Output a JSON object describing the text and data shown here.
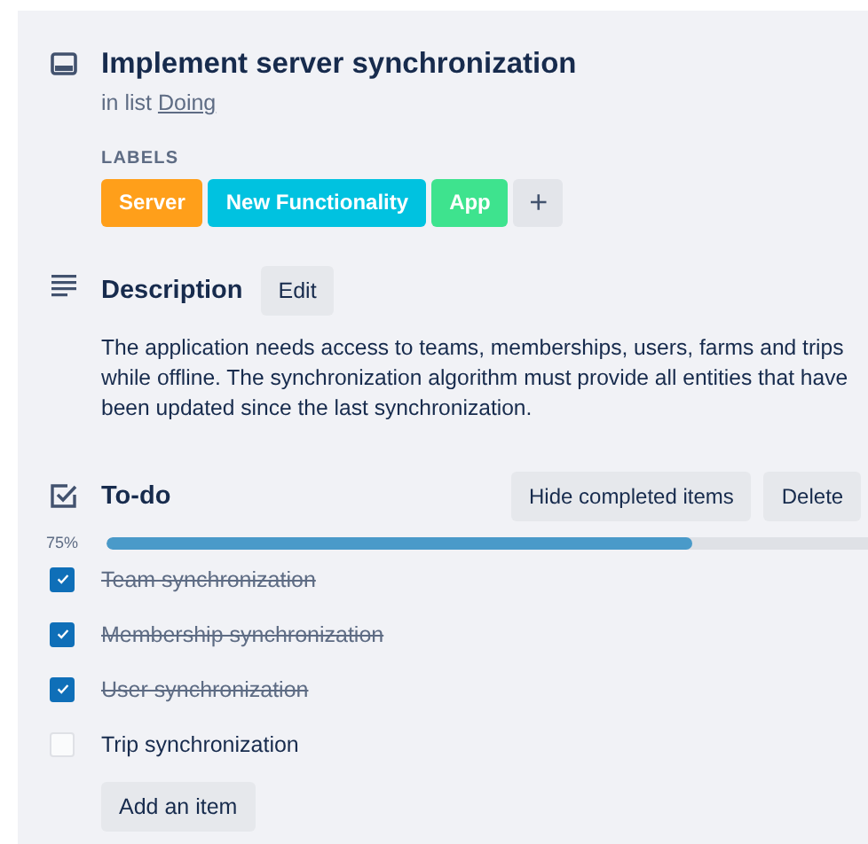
{
  "card": {
    "title": "Implement server synchronization",
    "list_prefix": "in list",
    "list_name": "Doing"
  },
  "labels": {
    "heading": "LABELS",
    "items": [
      {
        "text": "Server",
        "color": "#ff9f1a"
      },
      {
        "text": "New Functionality",
        "color": "#00c2e0"
      },
      {
        "text": "App",
        "color": "#3ee38e"
      }
    ],
    "add": "+"
  },
  "description": {
    "heading": "Description",
    "edit": "Edit",
    "text": "The application needs access to teams, memberships, users, farms and trips\nwhile offline. The synchronization algorithm must provide all entities that have\nbeen updated since the last synchronization."
  },
  "checklist": {
    "heading": "To-do",
    "buttons": [
      "Hide completed items",
      "Delete"
    ],
    "percent": "75%",
    "level": 0.75,
    "items": [
      {
        "text": "Team synchronization",
        "checked": true
      },
      {
        "text": "Membership synchronization",
        "checked": true
      },
      {
        "text": "User synchronization",
        "checked": true
      },
      {
        "text": "Trip synchronization",
        "checked": false
      }
    ],
    "add": "Add an item"
  }
}
